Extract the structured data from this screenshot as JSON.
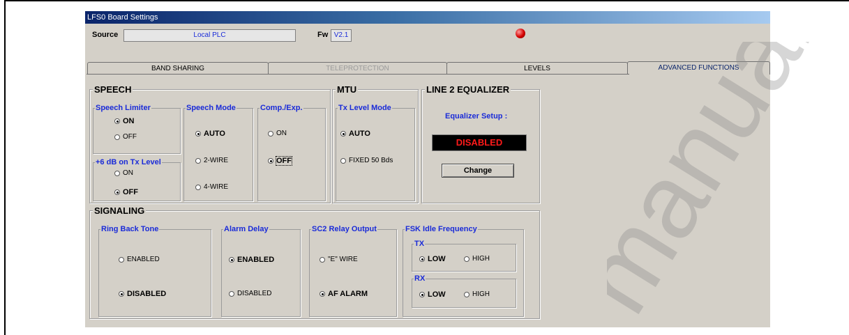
{
  "window": {
    "title": "LFS0 Board Settings"
  },
  "header": {
    "source_label": "Source",
    "source_value": "Local PLC",
    "fw_label": "Fw",
    "fw_value": "V2.1"
  },
  "tabs": [
    {
      "label": "BAND SHARING",
      "state": "normal"
    },
    {
      "label": "TELEPROTECTION",
      "state": "disabled"
    },
    {
      "label": "LEVELS",
      "state": "normal"
    },
    {
      "label": "ADVANCED FUNCTIONS",
      "state": "active"
    }
  ],
  "speech": {
    "title": "SPEECH",
    "limiter": {
      "title": "Speech Limiter",
      "on": "ON",
      "off": "OFF",
      "selected": "ON"
    },
    "tx_level": {
      "title": "+6 dB on Tx Level",
      "on": "ON",
      "off": "OFF",
      "selected": "OFF"
    },
    "mode": {
      "title": "Speech Mode",
      "auto": "AUTO",
      "two_wire": "2-WIRE",
      "four_wire": "4-WIRE",
      "selected": "AUTO"
    },
    "comp": {
      "title": "Comp./Exp.",
      "on": "ON",
      "off": "OFF",
      "selected": "OFF"
    }
  },
  "mtu": {
    "title": "MTU",
    "tx_level_mode": {
      "title": "Tx Level Mode",
      "auto": "AUTO",
      "fixed": "FIXED 50 Bds",
      "selected": "AUTO"
    }
  },
  "equalizer": {
    "title": "LINE 2 EQUALIZER",
    "setup_label": "Equalizer Setup :",
    "status": "DISABLED",
    "status_color": "#ff1a1a",
    "change_button": "Change"
  },
  "signaling": {
    "title": "SIGNALING",
    "ring_back": {
      "title": "Ring Back Tone",
      "enabled": "ENABLED",
      "disabled": "DISABLED",
      "selected": "DISABLED"
    },
    "alarm_delay": {
      "title": "Alarm Delay",
      "enabled": "ENABLED",
      "disabled": "DISABLED",
      "selected": "ENABLED"
    },
    "sc2": {
      "title": "SC2 Relay Output",
      "e_wire": "\"E\" WIRE",
      "af_alarm": "AF ALARM",
      "selected": "AF ALARM"
    },
    "fsk": {
      "title": "FSK Idle Frequency",
      "tx": {
        "title": "TX",
        "low": "LOW",
        "high": "HIGH",
        "selected": "LOW"
      },
      "rx": {
        "title": "RX",
        "low": "LOW",
        "high": "HIGH",
        "selected": "LOW"
      }
    }
  },
  "colors": {
    "label_blue": "#1a2bd8",
    "panel": "#d4d0c8",
    "led": "#d40000"
  },
  "watermark": "manuals"
}
